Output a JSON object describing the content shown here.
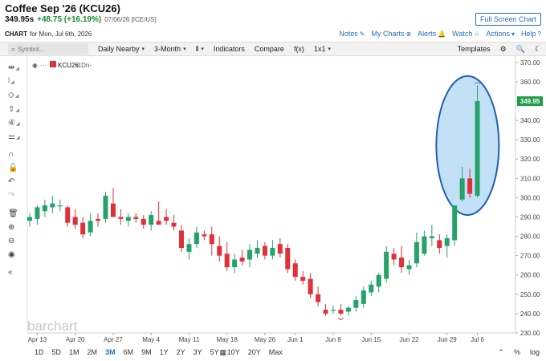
{
  "header": {
    "title": "Coffee Sep '26 (KCU26)",
    "full_screen_label": "Full Screen Chart",
    "price": "349.95s",
    "change": "+48.75 (+16.19%)",
    "date_exchange": "07/06/26 [ICE/US]",
    "chart_label": "CHART",
    "chart_for": "for Mon, Jul 6th, 2026"
  },
  "links": {
    "notes": "Notes",
    "my_charts": "My Charts",
    "alerts": "Alerts",
    "watch": "Watch",
    "actions": "Actions",
    "help": "Help"
  },
  "toolbar": {
    "symbol_placeholder": "Symbol...",
    "interval": "Daily Nearby",
    "period": "3-Month",
    "indicators": "Indicators",
    "compare": "Compare",
    "fx": "f(x)",
    "layout": "1x1",
    "templates": "Templates"
  },
  "legend": {
    "symbol": "KCU26",
    "interval": "-1Dn-"
  },
  "watermark": "barchart",
  "bottom": {
    "ranges": [
      "1D",
      "5D",
      "1M",
      "2M",
      "3M",
      "6M",
      "9M",
      "1Y",
      "2Y",
      "3Y",
      "5Y",
      "10Y",
      "20Y",
      "Max"
    ],
    "active_range": "3M",
    "percent": "%",
    "log": "log"
  },
  "colors": {
    "up": "#26a269",
    "down": "#e0313b",
    "price_tag": "#1f9e4a",
    "highlight_fill": "#b7daf5",
    "highlight_stroke": "#1f5fb3",
    "link": "#2a6ebb"
  },
  "chart_data": {
    "type": "candlestick",
    "ylim": [
      230,
      372
    ],
    "yticks": [
      230,
      240,
      250,
      260,
      270,
      280,
      290,
      300,
      310,
      320,
      330,
      340,
      350,
      360,
      370
    ],
    "last_price": "349.95",
    "xlabels": [
      {
        "label": "Apr 13",
        "index": 1
      },
      {
        "label": "Apr 20",
        "index": 6
      },
      {
        "label": "Apr 27",
        "index": 11
      },
      {
        "label": "May 4",
        "index": 16
      },
      {
        "label": "May 11",
        "index": 21
      },
      {
        "label": "May 18",
        "index": 26
      },
      {
        "label": "May 26",
        "index": 31
      },
      {
        "label": "Jun 1",
        "index": 35
      },
      {
        "label": "Jun 8",
        "index": 40
      },
      {
        "label": "Jun 15",
        "index": 45
      },
      {
        "label": "Jun 22",
        "index": 50
      },
      {
        "label": "Jun 29",
        "index": 55
      },
      {
        "label": "Jul 6",
        "index": 59
      }
    ],
    "candles": [
      {
        "o": 288,
        "h": 292,
        "l": 285,
        "c": 290
      },
      {
        "o": 289,
        "h": 296,
        "l": 286,
        "c": 295
      },
      {
        "o": 293,
        "h": 299,
        "l": 290,
        "c": 296
      },
      {
        "o": 295,
        "h": 301,
        "l": 292,
        "c": 297
      },
      {
        "o": 296,
        "h": 299,
        "l": 293,
        "c": 296
      },
      {
        "o": 295,
        "h": 296,
        "l": 285,
        "c": 287
      },
      {
        "o": 290,
        "h": 294,
        "l": 284,
        "c": 286
      },
      {
        "o": 287,
        "h": 290,
        "l": 279,
        "c": 281
      },
      {
        "o": 282,
        "h": 292,
        "l": 280,
        "c": 288
      },
      {
        "o": 289,
        "h": 292,
        "l": 285,
        "c": 288
      },
      {
        "o": 289,
        "h": 303,
        "l": 287,
        "c": 301
      },
      {
        "o": 297,
        "h": 305,
        "l": 291,
        "c": 290
      },
      {
        "o": 290,
        "h": 294,
        "l": 286,
        "c": 289
      },
      {
        "o": 288,
        "h": 292,
        "l": 285,
        "c": 290
      },
      {
        "o": 290,
        "h": 292,
        "l": 287,
        "c": 289
      },
      {
        "o": 289,
        "h": 291,
        "l": 284,
        "c": 286
      },
      {
        "o": 286,
        "h": 293,
        "l": 283,
        "c": 291
      },
      {
        "o": 288,
        "h": 298,
        "l": 286,
        "c": 286
      },
      {
        "o": 290,
        "h": 294,
        "l": 286,
        "c": 288
      },
      {
        "o": 287,
        "h": 291,
        "l": 283,
        "c": 285
      },
      {
        "o": 283,
        "h": 286,
        "l": 272,
        "c": 274
      },
      {
        "o": 272,
        "h": 279,
        "l": 268,
        "c": 276
      },
      {
        "o": 276,
        "h": 285,
        "l": 274,
        "c": 282
      },
      {
        "o": 281,
        "h": 283,
        "l": 278,
        "c": 280
      },
      {
        "o": 281,
        "h": 285,
        "l": 270,
        "c": 276
      },
      {
        "o": 275,
        "h": 280,
        "l": 267,
        "c": 270
      },
      {
        "o": 271,
        "h": 277,
        "l": 262,
        "c": 264
      },
      {
        "o": 264,
        "h": 271,
        "l": 261,
        "c": 268
      },
      {
        "o": 269,
        "h": 273,
        "l": 265,
        "c": 267
      },
      {
        "o": 268,
        "h": 276,
        "l": 264,
        "c": 273
      },
      {
        "o": 271,
        "h": 278,
        "l": 269,
        "c": 274
      },
      {
        "o": 275,
        "h": 277,
        "l": 268,
        "c": 270
      },
      {
        "o": 270,
        "h": 278,
        "l": 268,
        "c": 274
      },
      {
        "o": 276,
        "h": 279,
        "l": 269,
        "c": 271
      },
      {
        "o": 274,
        "h": 276,
        "l": 261,
        "c": 263
      },
      {
        "o": 266,
        "h": 268,
        "l": 257,
        "c": 259
      },
      {
        "o": 259,
        "h": 262,
        "l": 255,
        "c": 257
      },
      {
        "o": 258,
        "h": 261,
        "l": 248,
        "c": 250
      },
      {
        "o": 250,
        "h": 254,
        "l": 244,
        "c": 246
      },
      {
        "o": 242,
        "h": 245,
        "l": 239,
        "c": 240
      },
      {
        "o": 242,
        "h": 244,
        "l": 240,
        "c": 242
      },
      {
        "o": 242,
        "h": 245,
        "l": 239,
        "c": 240
      },
      {
        "o": 241,
        "h": 244,
        "l": 239,
        "c": 243
      },
      {
        "o": 243,
        "h": 249,
        "l": 241,
        "c": 247
      },
      {
        "o": 245,
        "h": 254,
        "l": 243,
        "c": 252
      },
      {
        "o": 251,
        "h": 257,
        "l": 249,
        "c": 255
      },
      {
        "o": 254,
        "h": 261,
        "l": 251,
        "c": 260
      },
      {
        "o": 258,
        "h": 275,
        "l": 256,
        "c": 272
      },
      {
        "o": 271,
        "h": 274,
        "l": 265,
        "c": 268
      },
      {
        "o": 269,
        "h": 275,
        "l": 261,
        "c": 264
      },
      {
        "o": 263,
        "h": 268,
        "l": 260,
        "c": 265
      },
      {
        "o": 266,
        "h": 282,
        "l": 264,
        "c": 277
      },
      {
        "o": 271,
        "h": 283,
        "l": 270,
        "c": 280
      },
      {
        "o": 279,
        "h": 286,
        "l": 275,
        "c": 280
      },
      {
        "o": 278,
        "h": 281,
        "l": 271,
        "c": 274
      },
      {
        "o": 275,
        "h": 281,
        "l": 269,
        "c": 279
      },
      {
        "o": 278,
        "h": 292,
        "l": 275,
        "c": 296
      },
      {
        "o": 299,
        "h": 316,
        "l": 298,
        "c": 310
      },
      {
        "o": 310,
        "h": 315,
        "l": 300,
        "c": 302
      },
      {
        "o": 301,
        "h": 358,
        "l": 300,
        "c": 349.95
      }
    ]
  }
}
